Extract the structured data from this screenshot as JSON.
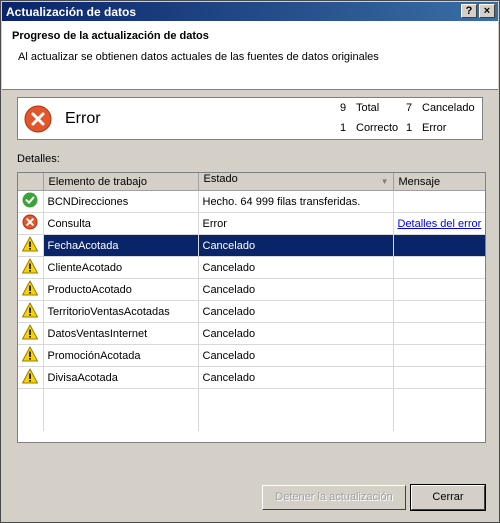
{
  "window": {
    "title": "Actualización de datos",
    "help_label": "?",
    "close_label": "×"
  },
  "header": {
    "title": "Progreso de la actualización de datos",
    "subtitle": "Al actualizar se obtienen datos actuales de las fuentes de datos originales"
  },
  "summary": {
    "status": "Error",
    "status_icon": "error-icon",
    "stats": [
      {
        "count": "9",
        "label": "Total"
      },
      {
        "count": "7",
        "label": "Cancelado"
      },
      {
        "count": "1",
        "label": "Correcto"
      },
      {
        "count": "1",
        "label": "Error"
      }
    ]
  },
  "details_label": "Detalles:",
  "grid": {
    "columns": [
      "Elemento de trabajo",
      "Estado",
      "Mensaje"
    ],
    "rows": [
      {
        "icon": "success",
        "item": "BCNDirecciones",
        "state": "Hecho. 64 999 filas transferidas.",
        "message": ""
      },
      {
        "icon": "error",
        "item": "Consulta",
        "state": "Error",
        "message": "Detalles del error"
      },
      {
        "icon": "warning",
        "item": "FechaAcotada",
        "state": "Cancelado",
        "message": "",
        "selected": true
      },
      {
        "icon": "warning",
        "item": "ClienteAcotado",
        "state": "Cancelado",
        "message": ""
      },
      {
        "icon": "warning",
        "item": "ProductoAcotado",
        "state": "Cancelado",
        "message": ""
      },
      {
        "icon": "warning",
        "item": "TerritorioVentasAcotadas",
        "state": "Cancelado",
        "message": ""
      },
      {
        "icon": "warning",
        "item": "DatosVentasInternet",
        "state": "Cancelado",
        "message": ""
      },
      {
        "icon": "warning",
        "item": "PromociónAcotada",
        "state": "Cancelado",
        "message": ""
      },
      {
        "icon": "warning",
        "item": "DivisaAcotada",
        "state": "Cancelado",
        "message": ""
      }
    ]
  },
  "buttons": {
    "stop": "Detener la actualización",
    "close": "Cerrar"
  },
  "colors": {
    "selection": "#0a246a",
    "error": "#e2562b",
    "success": "#3da13a",
    "warning": "#f5d400",
    "link": "#0000ee"
  }
}
